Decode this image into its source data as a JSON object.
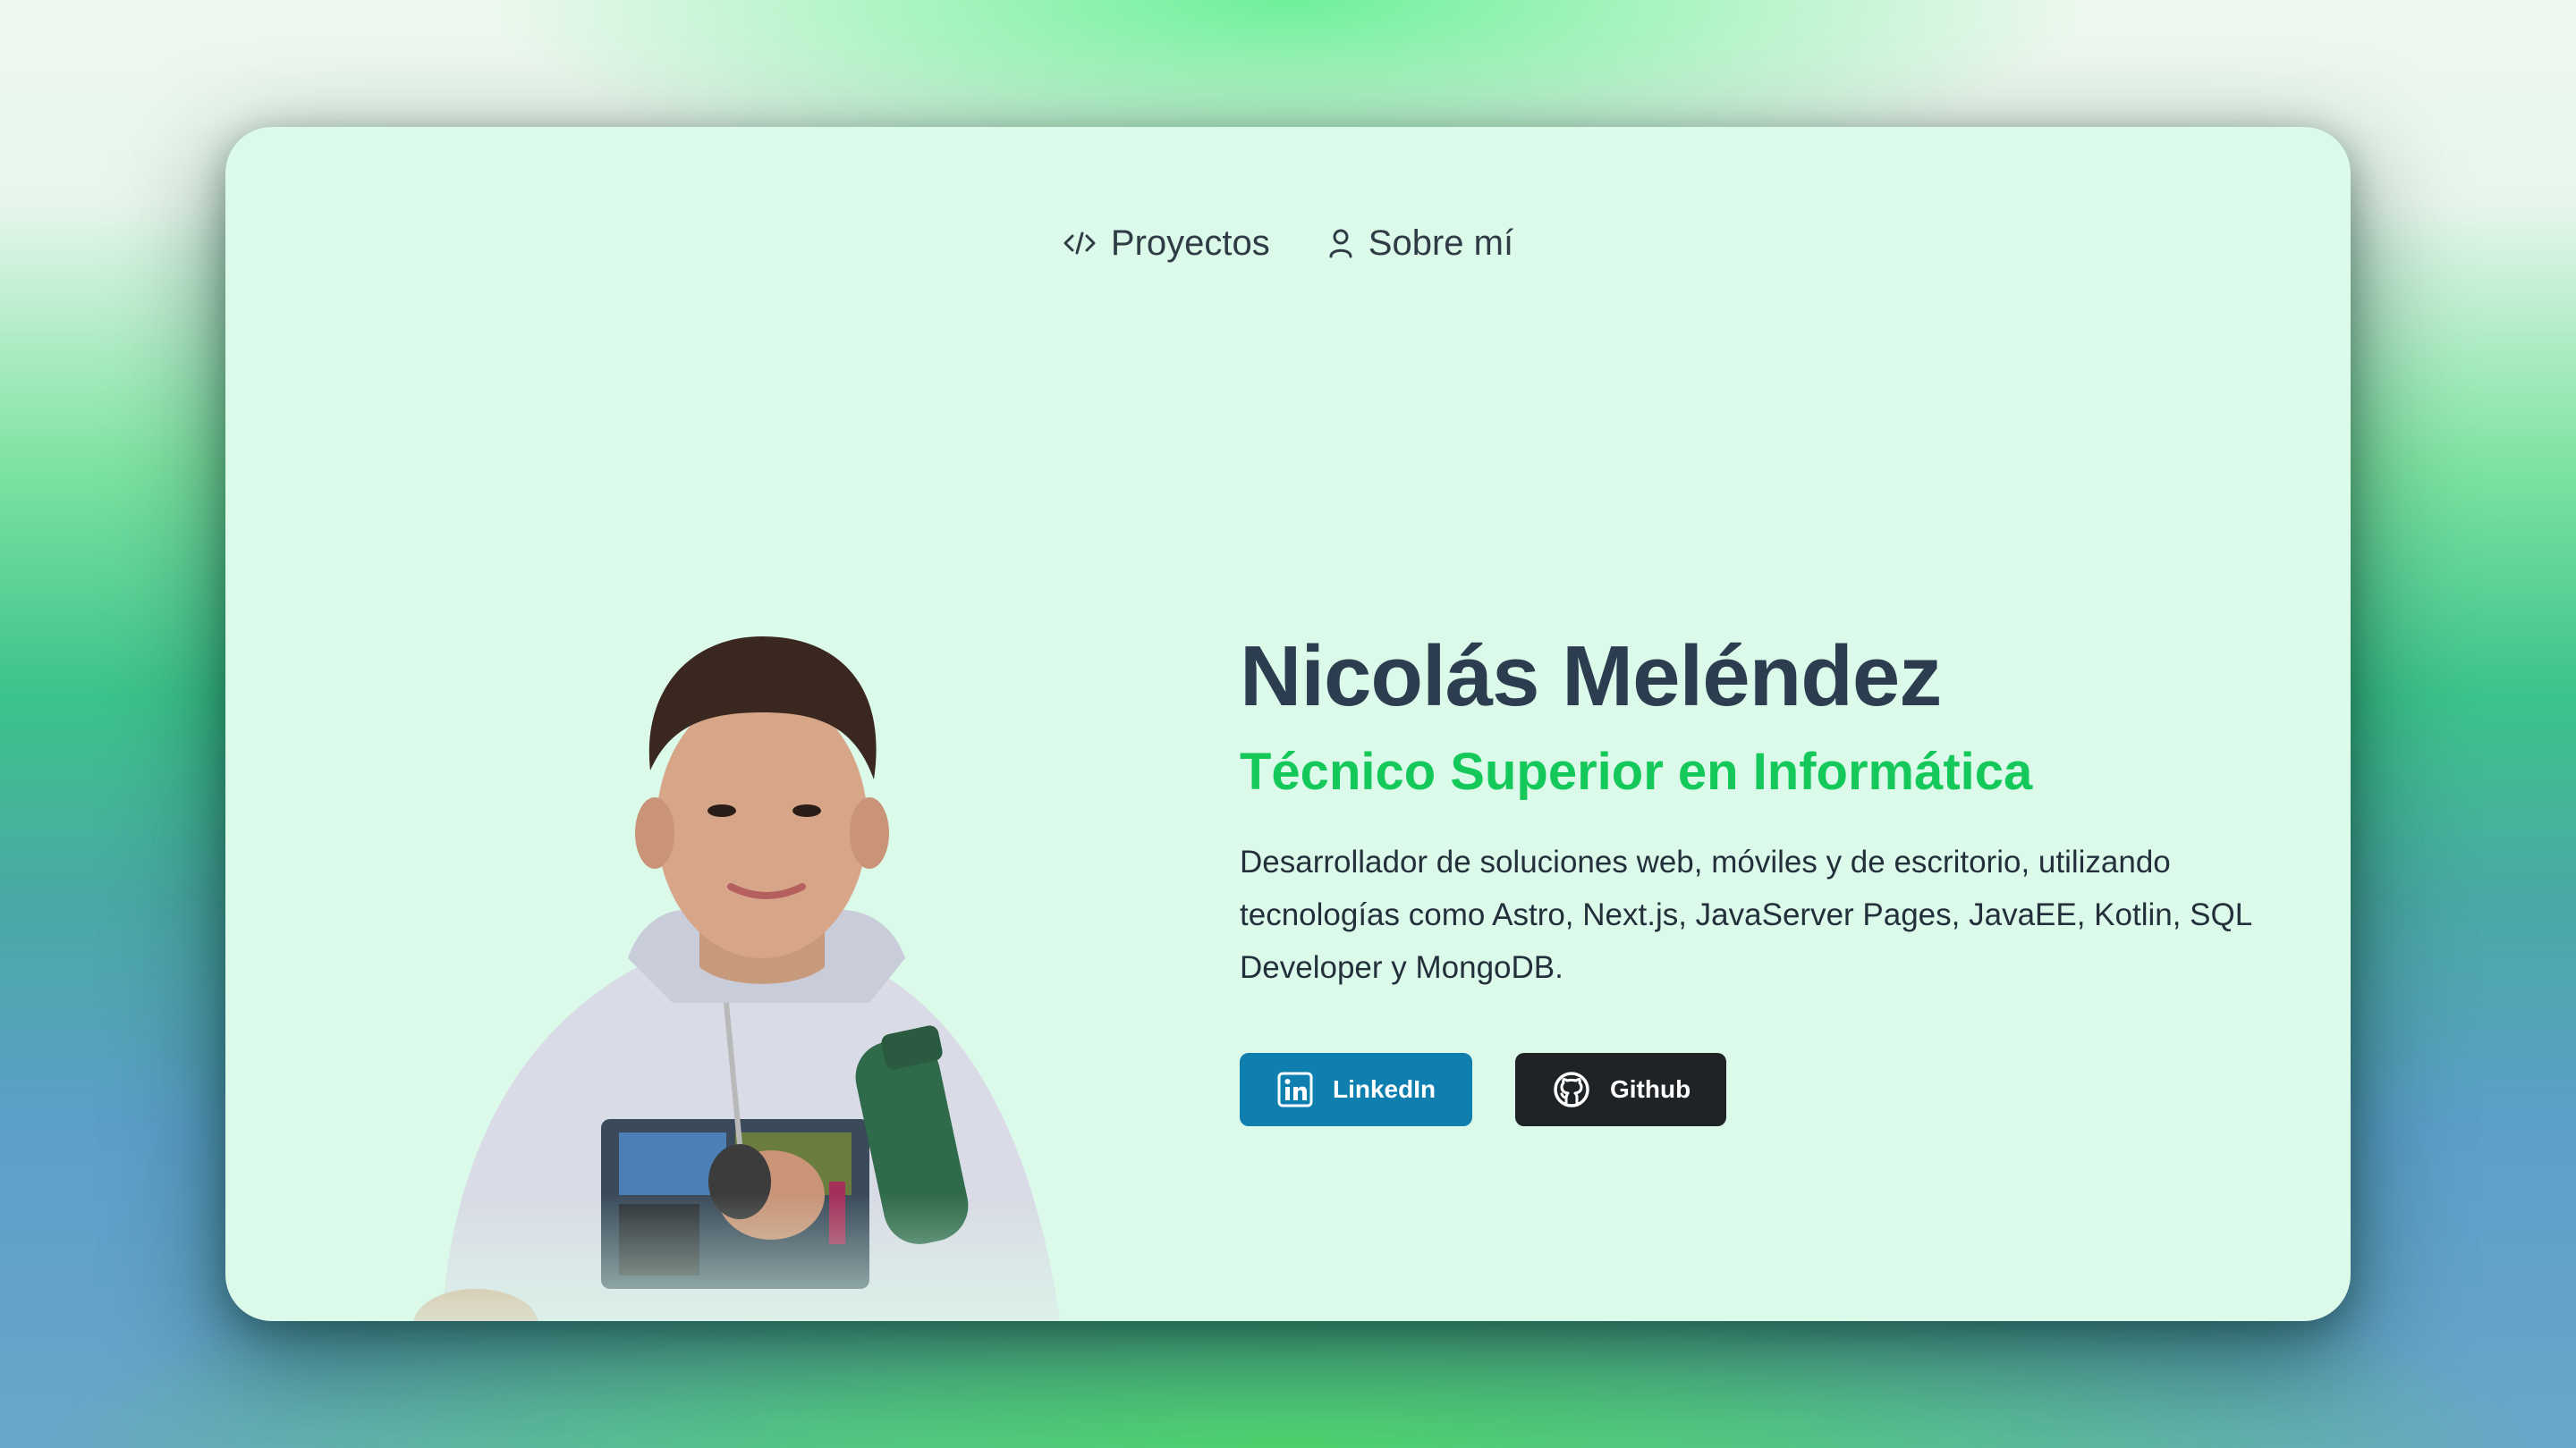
{
  "nav": {
    "items": [
      {
        "label": "Proyectos",
        "icon": "code-icon"
      },
      {
        "label": "Sobre mí",
        "icon": "user-icon"
      }
    ]
  },
  "hero": {
    "name": "Nicolás Meléndez",
    "title": "Técnico Superior en Informática",
    "description": "Desarrollador de soluciones web, móviles y de escritorio, utilizando tecnologías como Astro, Next.js, JavaServer Pages, JavaEE, Kotlin, SQL Developer y MongoDB.",
    "buttons": [
      {
        "label": "LinkedIn",
        "icon": "linkedin-icon",
        "color": "#0f7fb0"
      },
      {
        "label": "Github",
        "icon": "github-icon",
        "color": "#1f2326"
      }
    ]
  },
  "colors": {
    "card_bg": "#dcfaea",
    "name": "#2c3d4f",
    "accent": "#14c85a"
  }
}
